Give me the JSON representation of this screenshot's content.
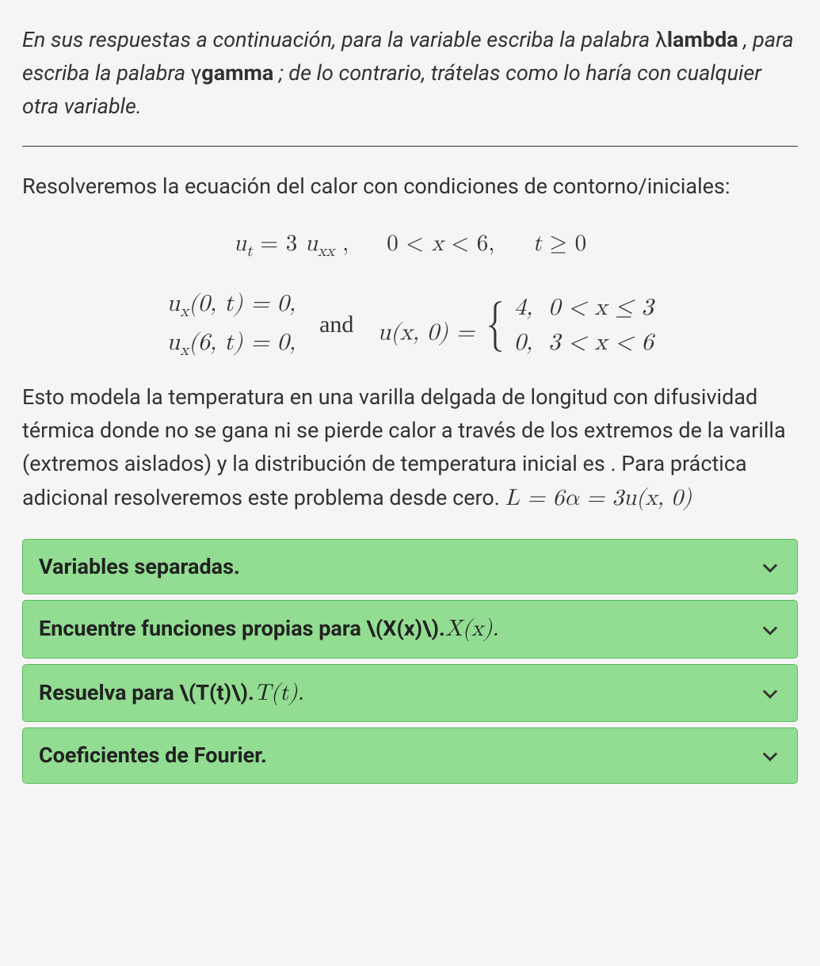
{
  "instructions": {
    "part1": "En sus respuestas a continuación, para la variable escriba la palabra ",
    "lambda_sym": "λ",
    "lambda_word": "lambda",
    "part2": " , para escriba la palabra ",
    "gamma_sym": "γ",
    "gamma_word": "gamma",
    "part3": " ; de lo contrario, trátelas como lo haría con cualquier otra variable."
  },
  "intro": "Resolveremos la ecuación del calor con condiciones de contorno/iniciales:",
  "equations": {
    "pde": "uₜ = 3 uₓₓ ,    0 < x < 6,    t ≥ 0",
    "bc1": "uₓ(0, t) = 0,",
    "bc2": "uₓ(6, t) = 0,",
    "and": "and",
    "ic_lhs": "u(x, 0) = ",
    "case1_val": "4,",
    "case1_cond": "0 < x ≤ 3",
    "case2_val": "0,",
    "case2_cond": "3 < x < 6"
  },
  "explanation": {
    "text": "Esto modela la temperatura en una varilla delgada de longitud con difusividad térmica donde no se gana ni se pierde calor a través de los extremos de la varilla (extremos aislados) y la distribución de temperatura inicial es . Para práctica adicional resolveremos este problema desde cero. ",
    "trailing_math": "L = 6α = 3u(x, 0)"
  },
  "accordion": [
    {
      "label": "Variables separadas.",
      "raw": "",
      "math": ""
    },
    {
      "label": "Encuentre funciones propias para ",
      "raw": "\\(X(x)\\).",
      "math": "X(x)."
    },
    {
      "label": "Resuelva para ",
      "raw": "\\(T(t)\\).",
      "math": "T(t)."
    },
    {
      "label": "Coeficientes de Fourier.",
      "raw": "",
      "math": ""
    }
  ]
}
